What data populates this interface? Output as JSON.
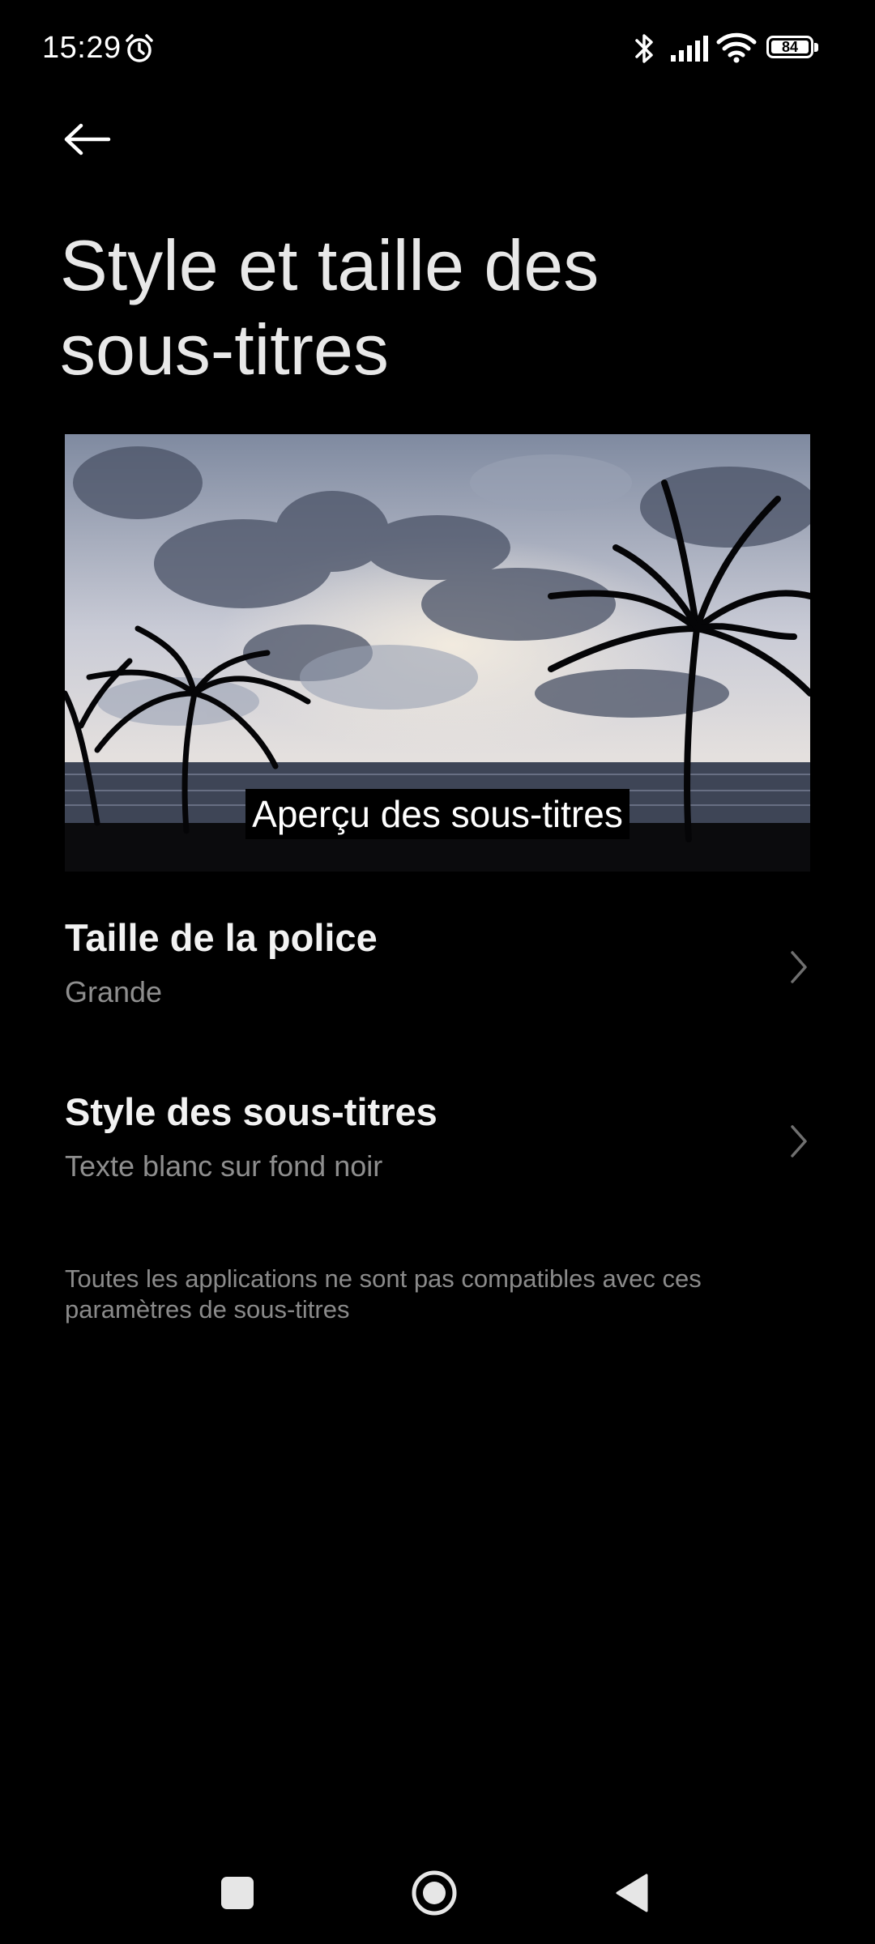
{
  "status_bar": {
    "time": "15:29",
    "battery_level": "84",
    "icons": [
      "alarm-icon",
      "bluetooth-icon",
      "signal-icon",
      "wifi-icon",
      "battery-icon"
    ]
  },
  "header": {
    "back_icon": "back-arrow-icon",
    "title": "Style et taille des sous-titres"
  },
  "preview": {
    "caption": "Aperçu des sous-titres"
  },
  "settings": [
    {
      "title": "Taille de la police",
      "value": "Grande",
      "icon": "chevron-right-icon"
    },
    {
      "title": "Style des sous-titres",
      "value": "Texte blanc sur fond noir",
      "icon": "chevron-right-icon"
    }
  ],
  "note": "Toutes les applications ne sont pas compatibles avec ces paramètres de sous-titres",
  "nav_bar": {
    "icons": [
      "recents-square-icon",
      "home-circle-icon",
      "back-triangle-icon"
    ]
  },
  "colors": {
    "background": "#000000",
    "title": "#e8e8e8",
    "secondary_text": "#8e8e8e"
  }
}
